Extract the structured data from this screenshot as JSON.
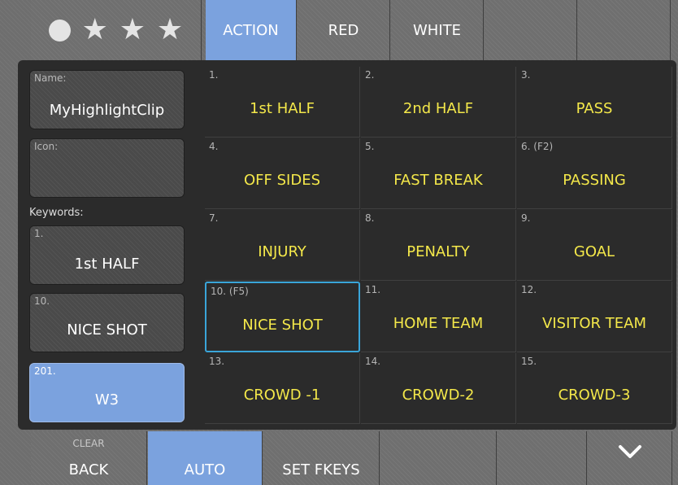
{
  "tabs": {
    "rating": {
      "filled_stars": 3,
      "total_stars": 3
    },
    "action": "ACTION",
    "red": "RED",
    "white": "WHITE"
  },
  "sidebar": {
    "name_label": "Name:",
    "name_value": "MyHighlightClip",
    "icon_label": "Icon:",
    "keywords_label": "Keywords:",
    "keywords": [
      {
        "num": "1.",
        "label": "1st HALF"
      },
      {
        "num": "10.",
        "label": "NICE SHOT"
      },
      {
        "num": "201.",
        "label": "W3"
      }
    ]
  },
  "grid": {
    "cells": [
      {
        "num": "1.",
        "label": "1st HALF"
      },
      {
        "num": "2.",
        "label": "2nd HALF"
      },
      {
        "num": "3.",
        "label": "PASS"
      },
      {
        "num": "4.",
        "label": "OFF SIDES"
      },
      {
        "num": "5.",
        "label": "FAST BREAK"
      },
      {
        "num": "6. (F2)",
        "label": "PASSING"
      },
      {
        "num": "7.",
        "label": "INJURY"
      },
      {
        "num": "8.",
        "label": "PENALTY"
      },
      {
        "num": "9.",
        "label": "GOAL"
      },
      {
        "num": "10. (F5)",
        "label": "NICE SHOT"
      },
      {
        "num": "11.",
        "label": "HOME TEAM"
      },
      {
        "num": "12.",
        "label": "VISITOR TEAM"
      },
      {
        "num": "13.",
        "label": "CROWD -1"
      },
      {
        "num": "14.",
        "label": "CROWD-2"
      },
      {
        "num": "15.",
        "label": "CROWD-3"
      }
    ]
  },
  "bottom": {
    "clear_label": "CLEAR",
    "back_label": "BACK",
    "auto_label": "AUTO",
    "set_fkeys_label": "SET FKEYS",
    "chevron_icon": "chevron-down-icon"
  },
  "colors": {
    "accent_blue": "#7ba2de",
    "keyword_yellow": "#f4e84a",
    "selection_border": "#3aa5d9",
    "panel_dark": "#2b2b2b"
  }
}
